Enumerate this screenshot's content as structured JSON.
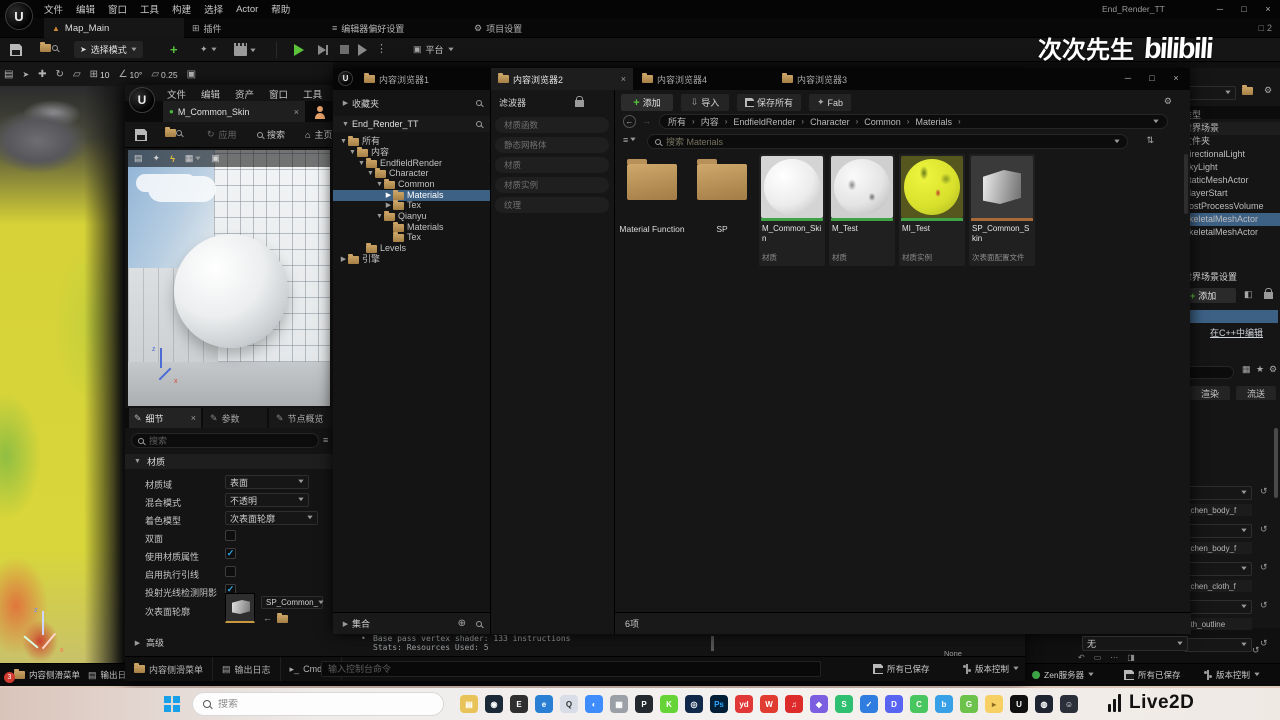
{
  "watermark": {
    "uploader": "次次先生",
    "platform": "bilibili"
  },
  "live2d": {
    "label": "Live2D"
  },
  "main": {
    "title": "End_Render_TT",
    "menus": [
      "文件",
      "编辑",
      "窗口",
      "工具",
      "构建",
      "选择",
      "Actor",
      "帮助"
    ],
    "level_tab": "Map_Main",
    "plugins": "插件",
    "editor_prefs": "编辑器偏好设置",
    "project_settings": "项目设置",
    "session_count": "2",
    "mode_button": "选择模式",
    "platform_button": "平台",
    "snap": {
      "grid": "10",
      "angle": "10°",
      "scale": "0.25"
    },
    "viewport_axis": {
      "up": "z",
      "right": "x"
    },
    "status": {
      "content_drawer": "内容侧滑菜单",
      "output_log": "输出日志",
      "badge": "3",
      "zen": "Zen服务器",
      "all_saved": "所有已保存",
      "version_control": "版本控制"
    },
    "outliner": {
      "type_header": "类型",
      "rows": [
        "世界场景",
        "文件夹",
        "DirectionalLight",
        "SkyLight",
        "StaticMeshActor",
        "PlayerStart",
        "PostProcessVolume",
        "SkeletalMeshActor",
        "SkeletalMeshActor"
      ],
      "selected": "SkeletalMeshActor"
    },
    "world_settings": {
      "title": "世界场景设置",
      "add": "添加",
      "edit_cpp": "在C++中编辑",
      "render": "渲染",
      "stream": "流送"
    },
    "material_slots": [
      "_chen_body_f",
      "_chen_body_f",
      "_chen_cloth_f",
      "oth_outline"
    ],
    "none_slot": {
      "value": "无",
      "caption": "None"
    },
    "colors": {
      "selection": "#3d6185",
      "accent_green": "#58c43c"
    }
  },
  "mat_editor": {
    "menus": [
      "文件",
      "编辑",
      "资产",
      "窗口",
      "工具"
    ],
    "tab": "M_Common_Skin",
    "toolbar": {
      "apply": "应用",
      "search": "搜索",
      "home": "主页"
    },
    "detail_tabs": [
      "细节",
      "参数",
      "节点概览"
    ],
    "search_placeholder": "搜索",
    "section": "材质",
    "props": {
      "domain_label": "材质域",
      "domain_value": "表面",
      "blend_label": "混合模式",
      "blend_value": "不透明",
      "shading_label": "着色模型",
      "shading_value": "次表面轮廓",
      "two_sided_label": "双面",
      "use_attrs_label": "使用材质属性",
      "exec_wire_label": "启用执行引线",
      "cast_shadow_label": "投射光线检测阴影",
      "subsurface_label": "次表面轮廓",
      "subsurface_value": "SP_Common_",
      "advanced_label": "高级"
    },
    "stats": {
      "line1": "Base pass vertex shader: 133 instructions",
      "line2": "Stats: Resources Used: 5"
    },
    "status": {
      "content_drawer": "内容侧滑菜单",
      "output_log": "输出日志",
      "cmd": "Cmd",
      "console_placeholder": "输入控制台命令",
      "all_saved": "所有已保存",
      "version_control": "版本控制"
    }
  },
  "cb": {
    "tabs": [
      "内容浏览器1",
      "内容浏览器2",
      "内容浏览器4",
      "内容浏览器3"
    ],
    "favorites": "收藏夹",
    "root": "End_Render_TT",
    "tree": [
      {
        "label": "所有"
      },
      {
        "label": "内容"
      },
      {
        "label": "EndfieldRender"
      },
      {
        "label": "Character"
      },
      {
        "label": "Common"
      },
      {
        "label": "Materials"
      },
      {
        "label": "Tex"
      },
      {
        "label": "Qianyu"
      },
      {
        "label": "Materials"
      },
      {
        "label": "Tex"
      },
      {
        "label": "Levels"
      },
      {
        "label": "引擎"
      }
    ],
    "collections": "集合",
    "filter_header": "滤波器",
    "filters": [
      "材质函数",
      "静态网格体",
      "材质",
      "材质实例",
      "纹理"
    ],
    "toolbar": {
      "add": "添加",
      "import": "导入",
      "save_all": "保存所有",
      "fab": "Fab"
    },
    "breadcrumbs": [
      "所有",
      "内容",
      "EndfieldRender",
      "Character",
      "Common",
      "Materials"
    ],
    "search_placeholder": "搜索 Materials",
    "count": "6项",
    "assets": [
      {
        "name": "Material Function",
        "kind": "folder",
        "type_label": ""
      },
      {
        "name": "SP",
        "kind": "folder",
        "type_label": ""
      },
      {
        "name": "M_Common_Skin",
        "kind": "material",
        "type_label": "材质",
        "stripe": "#3fa345"
      },
      {
        "name": "M_Test",
        "kind": "material",
        "type_label": "材质",
        "stripe": "#3fa345"
      },
      {
        "name": "MI_Test",
        "kind": "material-instance",
        "type_label": "材质实例",
        "stripe": "#3fa345"
      },
      {
        "name": "SP_Common_Skin",
        "kind": "subsurface-profile",
        "type_label": "次表面配置文件",
        "stripe": "#a86a38"
      }
    ]
  },
  "taskbar": {
    "search_placeholder": "搜索",
    "icons": [
      {
        "name": "file-explorer",
        "color": "#e8c35a",
        "glyph": "▤"
      },
      {
        "name": "steam",
        "color": "#1b2838",
        "glyph": "◉"
      },
      {
        "name": "epic-games",
        "color": "#2f2f2f",
        "glyph": "E"
      },
      {
        "name": "edge",
        "color": "#2a7fd4",
        "glyph": "e"
      },
      {
        "name": "qq",
        "color": "#d8dde8",
        "glyph": "Q"
      },
      {
        "name": "browser",
        "color": "#3f8cff",
        "glyph": "◐"
      },
      {
        "name": "pinned-app",
        "color": "#9aa0a6",
        "glyph": "▦"
      },
      {
        "name": "pycharm",
        "color": "#24292f",
        "glyph": "P"
      },
      {
        "name": "kook",
        "color": "#66d436",
        "glyph": "K"
      },
      {
        "name": "obs-studio",
        "color": "#10294a",
        "glyph": "◎"
      },
      {
        "name": "photoshop",
        "color": "#001e36",
        "glyph": "Ps"
      },
      {
        "name": "youdao-dict",
        "color": "#e23737",
        "glyph": "yd"
      },
      {
        "name": "wps-office",
        "color": "#e03c31",
        "glyph": "W"
      },
      {
        "name": "netease-music",
        "color": "#dd2a2a",
        "glyph": "♫"
      },
      {
        "name": "app-purple",
        "color": "#7c5fe0",
        "glyph": "◆"
      },
      {
        "name": "app-green",
        "color": "#2fbf71",
        "glyph": "S"
      },
      {
        "name": "app-blue",
        "color": "#2f7de1",
        "glyph": "✓"
      },
      {
        "name": "discord",
        "color": "#5865f2",
        "glyph": "D"
      },
      {
        "name": "wechat",
        "color": "#49c660",
        "glyph": "C"
      },
      {
        "name": "app-bird",
        "color": "#37a0e6",
        "glyph": "b"
      },
      {
        "name": "app-frog",
        "color": "#6cc24a",
        "glyph": "G"
      },
      {
        "name": "folder-app",
        "color": "#f7d064",
        "glyph": "▸"
      },
      {
        "name": "unreal-engine",
        "color": "#101010",
        "glyph": "U"
      },
      {
        "name": "app-dark",
        "color": "#1e2430",
        "glyph": "◍"
      },
      {
        "name": "app-face",
        "color": "#2b2f3a",
        "glyph": "☺"
      }
    ]
  }
}
